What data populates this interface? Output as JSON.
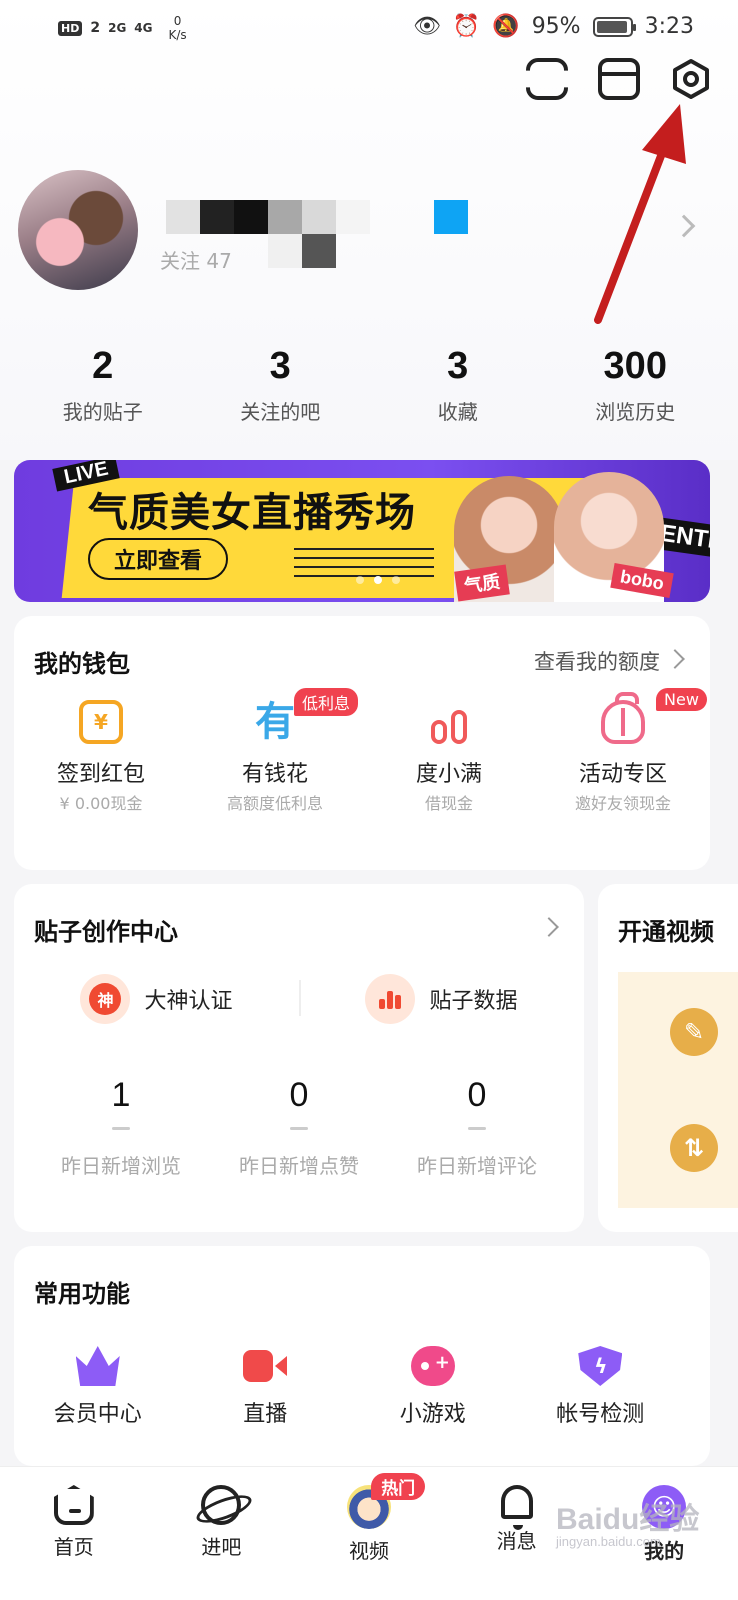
{
  "status_bar": {
    "hd": "HD",
    "sim": "2",
    "net1": "2G",
    "net2": "4G",
    "speed_value": "0",
    "speed_unit": "K/s",
    "battery": "95%",
    "time": "3:23"
  },
  "profile": {
    "follow_text": "关注 47"
  },
  "stats": [
    {
      "num": "2",
      "label": "我的贴子"
    },
    {
      "num": "3",
      "label": "关注的吧"
    },
    {
      "num": "3",
      "label": "收藏"
    },
    {
      "num": "300",
      "label": "浏览历史"
    }
  ],
  "banner": {
    "live": "LIVE",
    "title": "气质美女直播秀场",
    "button": "立即查看",
    "tag1": "气质",
    "tag2": "bobo",
    "side_text": "ENTE"
  },
  "wallet": {
    "title": "我的钱包",
    "link": "查看我的额度",
    "items": [
      {
        "name": "签到红包",
        "sub": "¥ 0.00现金",
        "badge": "",
        "icon_text": "¥"
      },
      {
        "name": "有钱花",
        "sub": "高额度低利息",
        "badge": "低利息",
        "icon_text": "有"
      },
      {
        "name": "度小满",
        "sub": "借现金",
        "badge": "",
        "icon_text": ""
      },
      {
        "name": "活动专区",
        "sub": "邀好友领现金",
        "badge": "New",
        "icon_text": ""
      }
    ]
  },
  "creator": {
    "title": "贴子创作中心",
    "actions": [
      {
        "label": "大神认证",
        "icon_text": "神"
      },
      {
        "label": "贴子数据",
        "icon_text": ""
      }
    ],
    "stats": [
      {
        "num": "1",
        "label": "昨日新增浏览"
      },
      {
        "num": "0",
        "label": "昨日新增点赞"
      },
      {
        "num": "0",
        "label": "昨日新增评论"
      }
    ]
  },
  "vip": {
    "title": "开通视频"
  },
  "common": {
    "title": "常用功能",
    "items": [
      {
        "label": "会员中心",
        "icon": "crown-icon"
      },
      {
        "label": "直播",
        "icon": "camera-icon"
      },
      {
        "label": "小游戏",
        "icon": "game-icon"
      },
      {
        "label": "帐号检测",
        "icon": "shield-icon"
      }
    ]
  },
  "nav": {
    "items": [
      {
        "label": "首页"
      },
      {
        "label": "进吧"
      },
      {
        "label": "视频",
        "badge": "热门"
      },
      {
        "label": "消息"
      },
      {
        "label": "我的"
      }
    ]
  },
  "watermark": {
    "main": "Baidu经验",
    "sub": "jingyan.baidu.com"
  },
  "colors": {
    "accent_red": "#f0424f",
    "annotation_arrow": "#c41e1e",
    "banner_purple": "#7b4ff0",
    "banner_yellow": "#ffd93a"
  }
}
